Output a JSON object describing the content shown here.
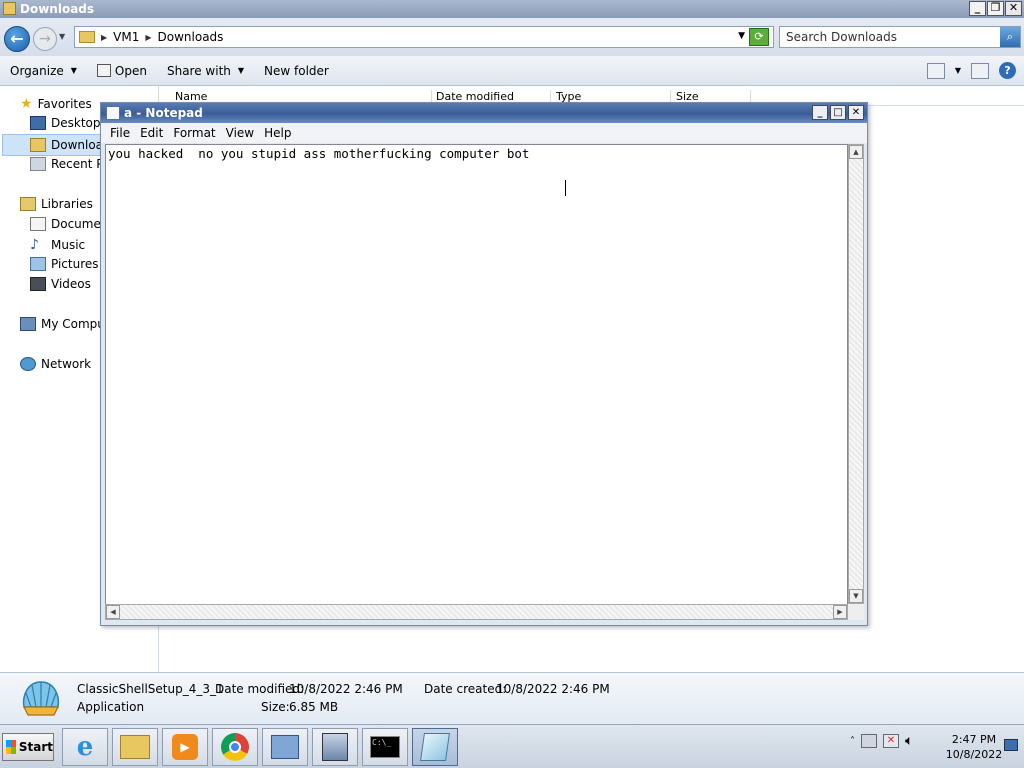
{
  "explorer": {
    "title": "Downloads",
    "breadcrumb": [
      "VM1",
      "Downloads"
    ],
    "search_placeholder": "Search Downloads",
    "toolbar": {
      "organize": "Organize",
      "open": "Open",
      "share_with": "Share with",
      "new_folder": "New folder"
    },
    "columns": [
      "Name",
      "Date modified",
      "Type",
      "Size"
    ],
    "sidebar": {
      "favorites": "Favorites",
      "desktop": "Desktop",
      "downloads": "Downloads",
      "recent": "Recent Pla",
      "libraries": "Libraries",
      "documents": "Document",
      "music": "Music",
      "pictures": "Pictures",
      "videos": "Videos",
      "computer": "My Compute",
      "network": "Network"
    },
    "details": {
      "filename": "ClassicShellSetup_4_3_1",
      "filetype": "Application",
      "date_modified_label": "Date modified:",
      "date_modified": "10/8/2022 2:46 PM",
      "date_created_label": "Date created:",
      "date_created": "10/8/2022 2:46 PM",
      "size_label": "Size:",
      "size": "6.85 MB"
    }
  },
  "notepad": {
    "title": "a - Notepad",
    "menu": [
      "File",
      "Edit",
      "Format",
      "View",
      "Help"
    ],
    "content": "you hacked  no you stupid ass motherfucking computer bot"
  },
  "taskbar": {
    "start_label": "Start",
    "time": "2:47 PM",
    "date": "10/8/2022",
    "apps": [
      "internet-explorer-icon",
      "file-explorer-icon",
      "media-player-icon",
      "chrome-icon",
      "server-manager-icon",
      "network-setup-icon",
      "command-prompt-icon",
      "notepad-icon"
    ]
  }
}
